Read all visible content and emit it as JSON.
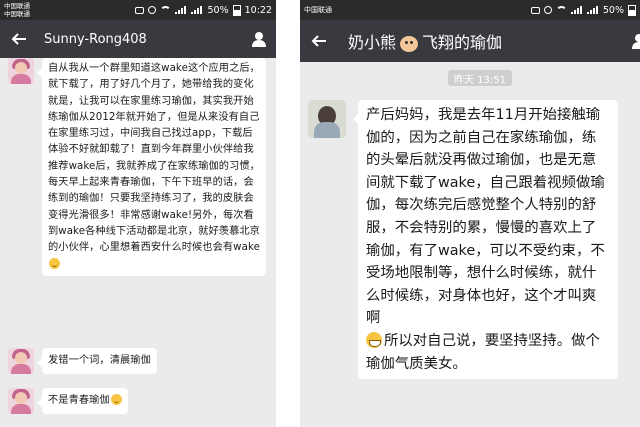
{
  "left": {
    "status": {
      "carrier1": "中国联通",
      "carrier2": "中国联通",
      "battery": "50%",
      "time": "10:22"
    },
    "header": {
      "title": "Sunny-Rong408"
    },
    "messages": [
      {
        "text": "自从我从一个群里知道这wake这个应用之后，就下载了，用了好几个月了，她带给我的变化就是，让我可以在家里练习瑜伽，其实我开始练瑜伽从2012年就开始了，但是从来没有自己在家里练习过，中间我自己找过app，下载后体验不好就卸载了！直到今年群里小伙伴给我推荐wake后，我就养成了在家练瑜伽的习惯，每天早上起来青春瑜伽，下午下班早的话，会练到的瑜伽！只要我坚持练习了，我的皮肤会变得光滑很多！非常感谢wake!另外，每次看到wake各种线下活动都是北京，就好羡慕北京的小伙伴，心里想着西安什么时候也会有wake"
      },
      {
        "text": "发错一个词，清晨瑜伽"
      },
      {
        "text": "不是青春瑜伽"
      }
    ]
  },
  "right": {
    "status": {
      "carrier": "中国联通",
      "battery": "50%"
    },
    "header": {
      "title_part1": "奶小熊",
      "title_part2": "飞翔的瑜伽"
    },
    "time_chip": "昨天 13:51",
    "message": {
      "text": "产后妈妈，我是去年11月开始接触瑜伽的，因为之前自己在家练瑜伽，练的头晕后就没再做过瑜伽，也是无意间就下载了wake，自己跟着视频做瑜伽，每次练完后感觉整个人特别的舒服，不会特别的累，慢慢的喜欢上了瑜伽，有了wake，可以不受约束，不受场地限制等，想什么时候练，就什么时候练，对身体也好，这个才叫爽啊",
      "text_after": "所以对自己说，要坚持坚持。做个瑜伽气质美女。"
    }
  }
}
